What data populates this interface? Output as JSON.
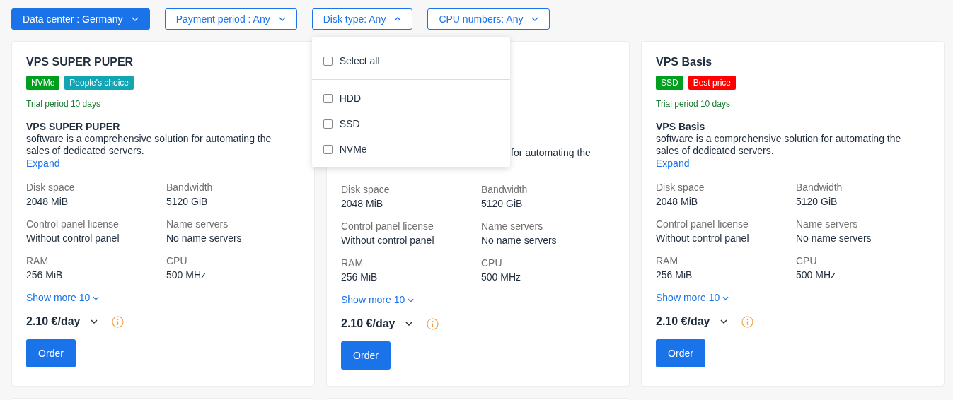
{
  "filters": [
    {
      "label": "Data center : Germany",
      "active": true,
      "expanded": false
    },
    {
      "label": "Payment period : Any",
      "active": false,
      "expanded": false
    },
    {
      "label": "Disk type: Any",
      "active": false,
      "expanded": true
    },
    {
      "label": "CPU numbers: Any",
      "active": false,
      "expanded": false
    }
  ],
  "disk_type_menu": {
    "select_all": {
      "label": "Select all",
      "checked": false
    },
    "options": [
      {
        "label": "HDD",
        "checked": false
      },
      {
        "label": "SSD",
        "checked": false
      },
      {
        "label": "NVMe",
        "checked": false
      }
    ]
  },
  "plans": [
    {
      "title": "VPS SUPER PUPER",
      "badges": [
        {
          "label": "NVMe",
          "color": "#00a01e"
        },
        {
          "label": "People's choice",
          "color": "#14a5b4"
        }
      ],
      "trial": "Trial period 10 days",
      "description_title": "VPS SUPER PUPER",
      "description": "software is a comprehensive solution for automating the sales of dedicated servers.",
      "expand": "Expand",
      "specs": [
        {
          "label": "Disk space",
          "value": "2048 MiB"
        },
        {
          "label": "Bandwidth",
          "value": "5120 GiB"
        },
        {
          "label": "Control panel license",
          "value": "Without control panel"
        },
        {
          "label": "Name servers",
          "value": "No name servers"
        },
        {
          "label": "RAM",
          "value": "256 MiB"
        },
        {
          "label": "CPU",
          "value": "500 MHz"
        }
      ],
      "show_more": "Show more 10",
      "price": "2.10 €/day",
      "order": "Order"
    },
    {
      "description_visible_part": "for automating the",
      "specs": [
        {
          "label": "Disk space",
          "value": "2048 MiB"
        },
        {
          "label": "Bandwidth",
          "value": "5120 GiB"
        },
        {
          "label": "Control panel license",
          "value": "Without control panel"
        },
        {
          "label": "Name servers",
          "value": "No name servers"
        },
        {
          "label": "RAM",
          "value": "256 MiB"
        },
        {
          "label": "CPU",
          "value": "500 MHz"
        }
      ],
      "show_more": "Show more 10",
      "price": "2.10 €/day",
      "order": "Order"
    },
    {
      "title": "VPS Basis",
      "badges": [
        {
          "label": "SSD",
          "color": "#00a01e"
        },
        {
          "label": "Best price",
          "color": "#ff0000"
        }
      ],
      "trial": "Trial period 10 days",
      "description_title": "VPS Basis",
      "description": "software is a comprehensive solution for automating the sales of dedicated servers.",
      "expand": "Expand",
      "specs": [
        {
          "label": "Disk space",
          "value": "2048 MiB"
        },
        {
          "label": "Bandwidth",
          "value": "5120 GiB"
        },
        {
          "label": "Control panel license",
          "value": "Without control panel"
        },
        {
          "label": "Name servers",
          "value": "No name servers"
        },
        {
          "label": "RAM",
          "value": "256 MiB"
        },
        {
          "label": "CPU",
          "value": "500 MHz"
        }
      ],
      "show_more": "Show more 10",
      "price": "2.10 €/day",
      "order": "Order"
    }
  ]
}
